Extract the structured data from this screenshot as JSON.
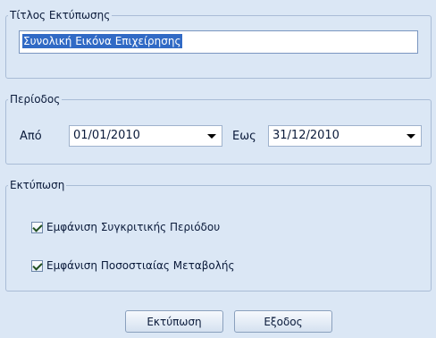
{
  "title_group": {
    "legend": "Τίτλος Εκτύπωσης",
    "value": "Συνολική Εικόνα Επιχείρησης"
  },
  "period_group": {
    "legend": "Περίοδος",
    "from_label": "Από",
    "from_value": "01/01/2010",
    "to_label": "Εως",
    "to_value": "31/12/2010"
  },
  "print_group": {
    "legend": "Εκτύπωση",
    "options": [
      {
        "label": "Εμφάνιση Συγκριτικής Περιόδου",
        "checked": true
      },
      {
        "label": "Εμφάνιση Ποσοστιαίας Μεταβολής",
        "checked": true
      }
    ]
  },
  "buttons": {
    "print_label": "Εκτύπωση",
    "exit_label": "Εξοδος"
  },
  "icons": {
    "dropdown": "chevron-down-icon",
    "check": "check-icon"
  }
}
